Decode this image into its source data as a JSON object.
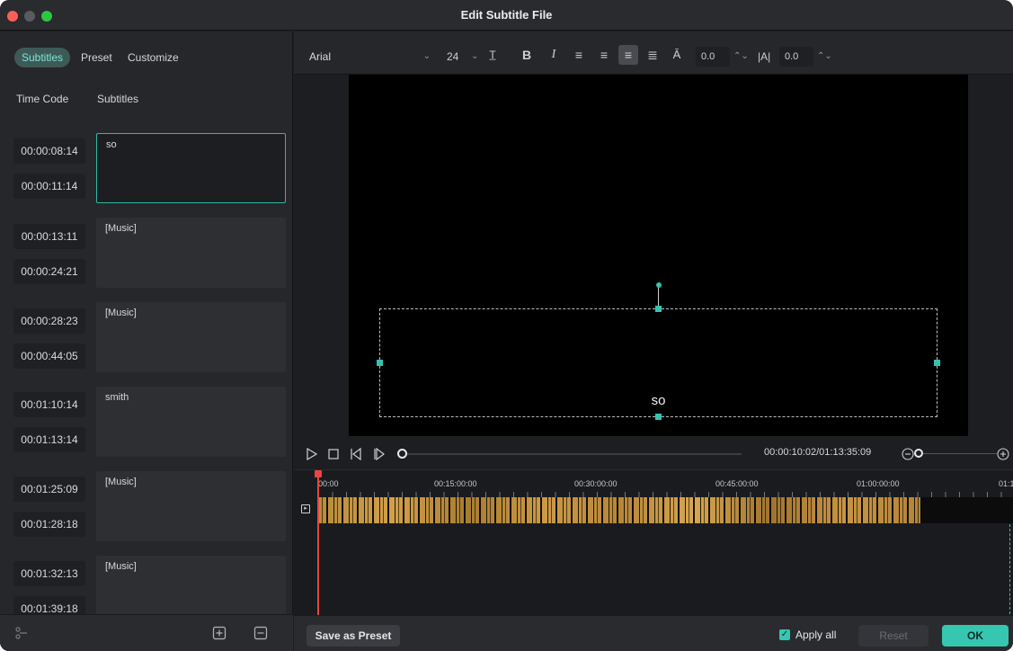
{
  "window": {
    "title": "Edit Subtitle File"
  },
  "left": {
    "tabs": [
      "Subtitles",
      "Preset",
      "Customize"
    ],
    "columns": {
      "timecode": "Time Code",
      "subtitles": "Subtitles"
    },
    "rows": [
      {
        "start": "00:00:08:14",
        "end": "00:00:11:14",
        "text": "so"
      },
      {
        "start": "00:00:13:11",
        "end": "00:00:24:21",
        "text": "[Music]"
      },
      {
        "start": "00:00:28:23",
        "end": "00:00:44:05",
        "text": "[Music]"
      },
      {
        "start": "00:01:10:14",
        "end": "00:01:13:14",
        "text": "smith"
      },
      {
        "start": "00:01:25:09",
        "end": "00:01:28:18",
        "text": "[Music]"
      },
      {
        "start": "00:01:32:13",
        "end": "00:01:39:18",
        "text": "[Music]"
      }
    ]
  },
  "toolbar": {
    "font": "Arial",
    "size": "24",
    "letter_spacing": "0.0",
    "line_spacing": "0.0",
    "icons": [
      "text-style-icon",
      "bold-icon",
      "italic-icon",
      "align-left-icon",
      "align-right-icon",
      "align-center-icon",
      "align-justify-icon",
      "baseline-icon",
      "letter-spacing-icon"
    ]
  },
  "preview": {
    "caption": "so"
  },
  "player": {
    "timecode": "00:00:10:02/01:13:35:09"
  },
  "timeline": {
    "ruler_labels": [
      "00:00",
      "00:15:00:00",
      "00:30:00:00",
      "00:45:00:00",
      "01:00:00:00",
      "01:1"
    ]
  },
  "bottom": {
    "save_preset": "Save as Preset",
    "apply_all": "Apply all",
    "reset": "Reset",
    "ok": "OK"
  },
  "colors": {
    "accent": "#35c7b0",
    "playhead": "#e84545",
    "clip": "#c8963f"
  }
}
